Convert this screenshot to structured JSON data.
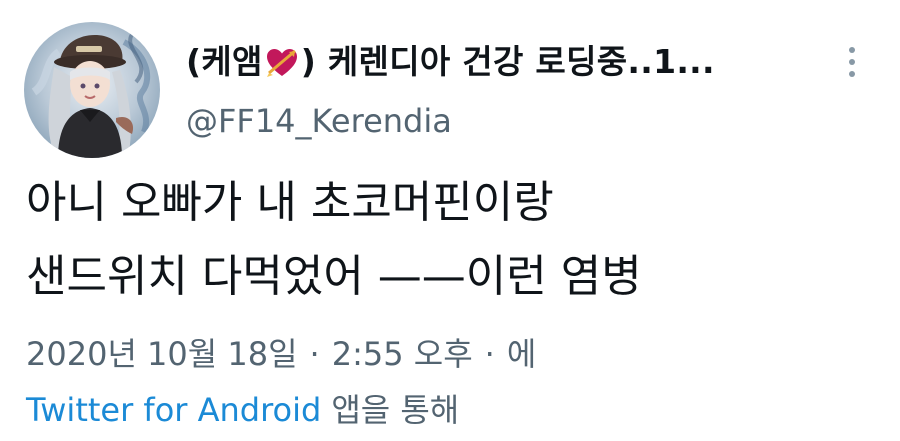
{
  "tweet": {
    "display_name_prefix": "(케앰",
    "display_name_suffix": ") 케렌디아 건강 로딩중..1...",
    "handle": "@FF14_Kerendia",
    "text_lines": [
      "아니 오빠가 내 초코머핀이랑",
      "샌드위치 다먹었어 ——이런 염병"
    ],
    "date": "2020년 10월 18일",
    "time": "2:55 오후",
    "dot": "·",
    "trailing": "에",
    "source_link": "Twitter for Android",
    "source_suffix": "앱을 통해"
  },
  "icons": {
    "more": "more-vertical-icon",
    "heart": "heart-with-arrow-emoji"
  },
  "colors": {
    "text": "#0f1419",
    "secondary": "#536471",
    "link": "#1b8ad6",
    "heart": "#c2185b"
  }
}
